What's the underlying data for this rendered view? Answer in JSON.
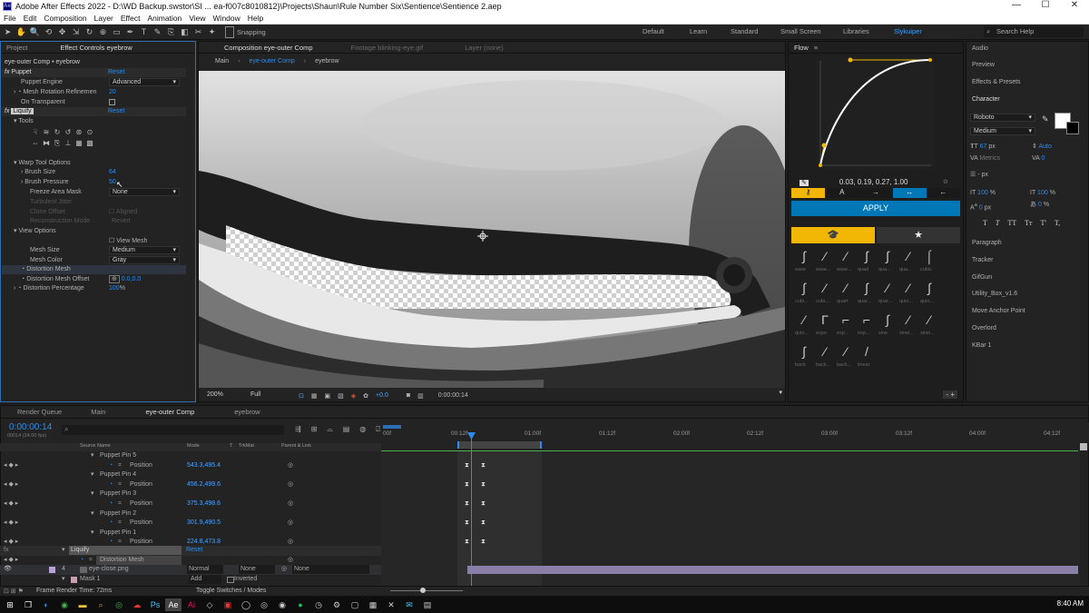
{
  "title_bar": {
    "title": "Adobe After Effects 2022 - D:\\WD Backup.swstor\\SI ... ea-f007c8010812}\\Projects\\Shaun\\Rule Number Six\\Sentience\\Sentience 2.aep",
    "app_icon": "Ae",
    "minimize": "—",
    "maximize": "☐",
    "close": "✕"
  },
  "menu": [
    "File",
    "Edit",
    "Composition",
    "Layer",
    "Effect",
    "Animation",
    "View",
    "Window",
    "Help"
  ],
  "toolbar": {
    "snapping": "Snapping",
    "workspaces": [
      "Default",
      "Learn",
      "Standard",
      "Small Screen",
      "Libraries",
      "Slykuiper"
    ],
    "search_placeholder": "Search Help"
  },
  "effect_controls": {
    "tabs": [
      "Project",
      "Effect Controls eyebrow"
    ],
    "header": "eye-outer Comp • eyebrow",
    "puppet": {
      "name": "Puppet",
      "reset": "Reset",
      "engine_label": "Puppet Engine",
      "engine_value": "Advanced",
      "mesh_rot_label": "Mesh Rotation Refinemen",
      "mesh_rot_value": "20",
      "on_transparent": "On Transparent"
    },
    "liquify": {
      "name": "Liquify",
      "reset": "Reset",
      "tools": "Tools",
      "warp_options": "Warp Tool Options",
      "brush_size_label": "Brush Size",
      "brush_size": "64",
      "brush_pressure_label": "Brush Pressure",
      "brush_pressure": "50",
      "freeze_label": "Freeze Area Mask",
      "freeze_value": "None",
      "turbulent": "Turbulent Jitter",
      "clone_offset": "Clone Offset",
      "aligned": "Aligned",
      "recon_mode": "Reconstruction Mode",
      "recon_value": "Revert",
      "view_options": "View Options",
      "view_mesh": "View Mesh",
      "mesh_size_label": "Mesh Size",
      "mesh_size": "Medium",
      "mesh_color_label": "Mesh Color",
      "mesh_color": "Gray",
      "distortion_mesh": "Distortion Mesh",
      "distortion_offset_label": "Distortion Mesh Offset",
      "distortion_offset": "0.0,0.0",
      "distortion_pct_label": "Distortion Percentage",
      "distortion_pct": "100",
      "pct": "%"
    }
  },
  "composition": {
    "tabs": [
      "Composition eye-outer Comp",
      "Footage blinking-eye.gif",
      "Layer (none)"
    ],
    "breadcrumbs": [
      "Main",
      "eye-outer Comp",
      "eyebrow"
    ],
    "zoom": "200%",
    "resolution": "Full",
    "exposure": "+0.0",
    "timecode": "0:00:00:14"
  },
  "flow": {
    "title": "Flow",
    "values": "0.03, 0.19, 0.27, 1.00",
    "apply": "APPLY",
    "ease_labels": [
      "ease",
      "ease...",
      "ease...",
      "quad",
      "qua...",
      "qua...",
      "cubic",
      "cubi...",
      "cubi...",
      "quart",
      "quar...",
      "quar...",
      "quin...",
      "quin...",
      "quin...",
      "expo",
      "exp...",
      "exp...",
      "sine",
      "sinei...",
      "sinei...",
      "back",
      "back...",
      "back...",
      "linear"
    ],
    "colors": {
      "accent": "#f2b705",
      "blue": "#0077b6"
    },
    "footer_minus": "-",
    "footer_plus": "+"
  },
  "right_panels": {
    "items": [
      "Audio",
      "Preview",
      "Effects & Presets",
      "Character"
    ],
    "lower_items": [
      "Paragraph",
      "Tracker",
      "GifGun",
      "Utility_Box_v1.6",
      "Move Anchor Point",
      "Overlord",
      "KBar 1"
    ],
    "character": {
      "font": "Roboto",
      "style": "Medium",
      "size": "67",
      "size_unit": "px",
      "leading": "Auto",
      "kerning": "Metrics",
      "tracking": "0",
      "stroke": "- px",
      "vscale": "100",
      "hscale": "100",
      "pct": "%",
      "baseline": "0",
      "baseline_unit": "px",
      "tsume": "0",
      "tsume_unit": "%",
      "styles": [
        "T",
        "T",
        "TT",
        "Tт",
        "T'",
        "T,"
      ]
    }
  },
  "timeline": {
    "tabs": [
      "Render Queue",
      "Main",
      "eye-outer Comp",
      "eyebrow"
    ],
    "timecode": "0:00:00:14",
    "frames": "00014 (24.00 fps)",
    "columns": [
      "Source Name",
      "Mode",
      "T",
      "TrkMat",
      "Parent & Link"
    ],
    "ruler": [
      "00f",
      "00:12f",
      "01:00f",
      "01:12f",
      "02:00f",
      "02:12f",
      "03:00f",
      "03:12f",
      "04:00f",
      "04:12f"
    ],
    "rows": [
      {
        "label": "Puppet Pin 5"
      },
      {
        "label": "Position",
        "value": "543.3,495.4"
      },
      {
        "label": "Puppet Pin 4"
      },
      {
        "label": "Position",
        "value": "456.2,499.6"
      },
      {
        "label": "Puppet Pin 3"
      },
      {
        "label": "Position",
        "value": "375.3,498.6"
      },
      {
        "label": "Puppet Pin 2"
      },
      {
        "label": "Position",
        "value": "301.9,490.5"
      },
      {
        "label": "Puppet Pin 1"
      },
      {
        "label": "Position",
        "value": "224.8,473.8"
      }
    ],
    "liquify": "Liquify",
    "liquify_reset": "Reset",
    "distortion_mesh": "Distortion Mesh",
    "layer_num": "4",
    "layer_name": "eye-close.png",
    "layer_mode": "Normal",
    "layer_trkmat": "None",
    "layer_parent": "None",
    "mask": "Mask 1",
    "mask_mode": "Add",
    "mask_inverted": "Inverted",
    "render_time": "Frame Render Time: 72ms",
    "toggle": "Toggle Switches / Modes"
  },
  "taskbar": {
    "clock": "8:40 AM"
  }
}
